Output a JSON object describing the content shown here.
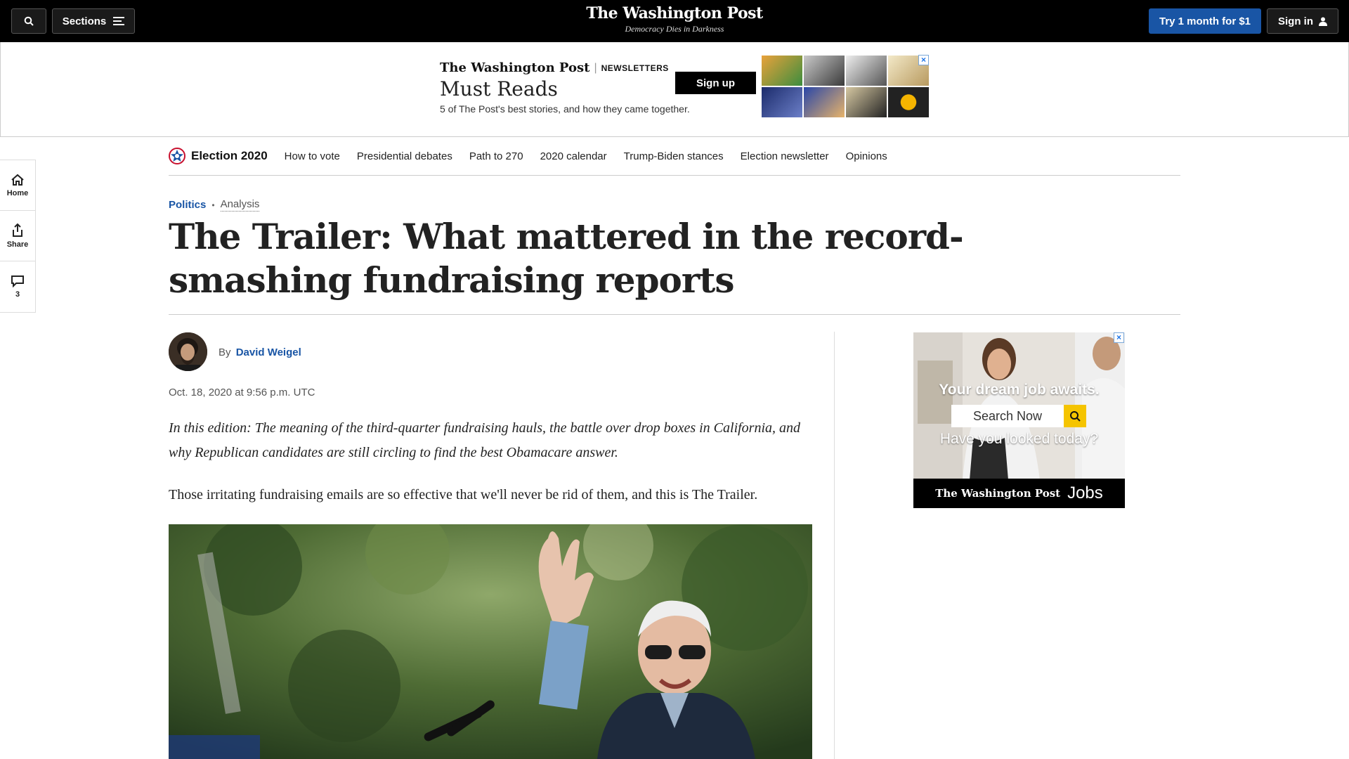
{
  "header": {
    "sections_label": "Sections",
    "logo": "The Washington Post",
    "tagline": "Democracy Dies in Darkness",
    "subscribe_label": "Try 1 month for $1",
    "signin_label": "Sign in"
  },
  "top_ad": {
    "brand": "The Washington Post",
    "section": "NEWSLETTERS",
    "title": "Must Reads",
    "description": "5 of The Post's best stories, and how they came together.",
    "cta": "Sign up"
  },
  "election_nav": {
    "label": "Election 2020",
    "links": [
      "How to vote",
      "Presidential debates",
      "Path to 270",
      "2020 calendar",
      "Trump-Biden stances",
      "Election newsletter",
      "Opinions"
    ]
  },
  "rail": {
    "home": "Home",
    "share": "Share",
    "comments_count": "3"
  },
  "article": {
    "section": "Politics",
    "label": "Analysis",
    "headline": "The Trailer: What mattered in the record-smashing fundraising reports",
    "byline_prefix": "By",
    "author": "David Weigel",
    "date": "Oct. 18, 2020 at 9:56 p.m. UTC",
    "deck": "In this edition: The meaning of the third-quarter fundraising hauls, the battle over drop boxes in California, and why Republican candidates are still circling to find the best Obamacare answer.",
    "lede": "Those irritating fundraising emails are so effective that we'll never be rid of them, and this is The Trailer."
  },
  "side_ad": {
    "headline": "Your dream job awaits.",
    "search_placeholder": "Search Now",
    "question": "Have you looked today?",
    "brand": "The Washington Post",
    "product": "Jobs"
  },
  "colors": {
    "accent": "#1955a5",
    "topbar": "#000000",
    "ad_yellow": "#f5c400"
  }
}
